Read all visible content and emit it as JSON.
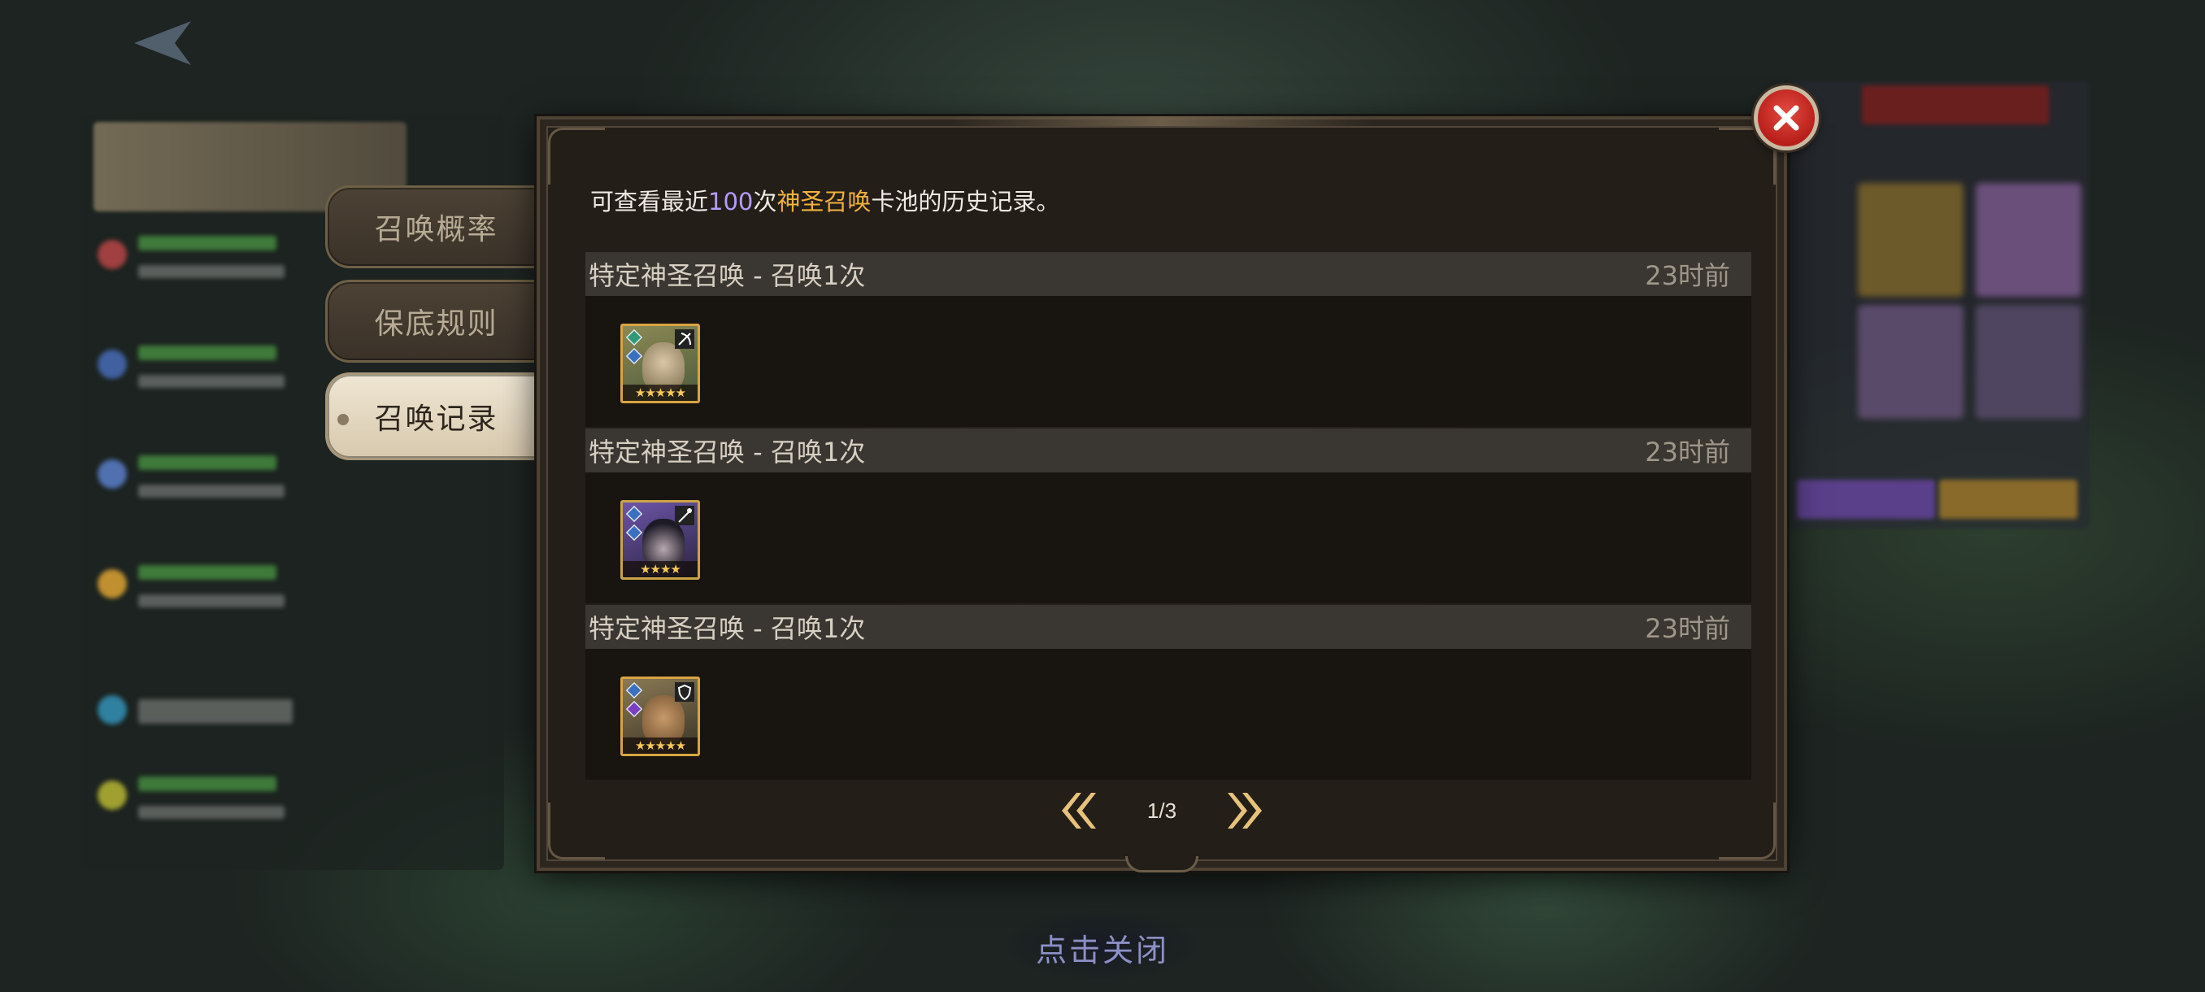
{
  "side_tabs": [
    {
      "label": "召唤概率",
      "active": false
    },
    {
      "label": "保底规则",
      "active": false
    },
    {
      "label": "召唤记录",
      "active": true
    }
  ],
  "dialog": {
    "desc_prefix": "可查看最近",
    "desc_count": "100",
    "desc_mid": "次",
    "desc_pool": "神圣召唤",
    "desc_suffix": "卡池的历史记录。",
    "records": [
      {
        "title": "特定神圣召唤 - 召唤1次",
        "time": "23时前",
        "hero_icon": "hero-portrait-green-elf",
        "stars": "★★★★★"
      },
      {
        "title": "特定神圣召唤 - 召唤1次",
        "time": "23时前",
        "hero_icon": "hero-portrait-hooded-mage",
        "stars": "★★★★"
      },
      {
        "title": "特定神圣召唤 - 召唤1次",
        "time": "23时前",
        "hero_icon": "hero-portrait-dwarf",
        "stars": "★★★★★"
      }
    ],
    "pager": {
      "page": "1/3"
    }
  },
  "tap_to_close": "点击关闭",
  "colors": {
    "count_highlight": "#b39cff",
    "pool_highlight": "#f3b13d",
    "close_button": "#c8261f"
  }
}
